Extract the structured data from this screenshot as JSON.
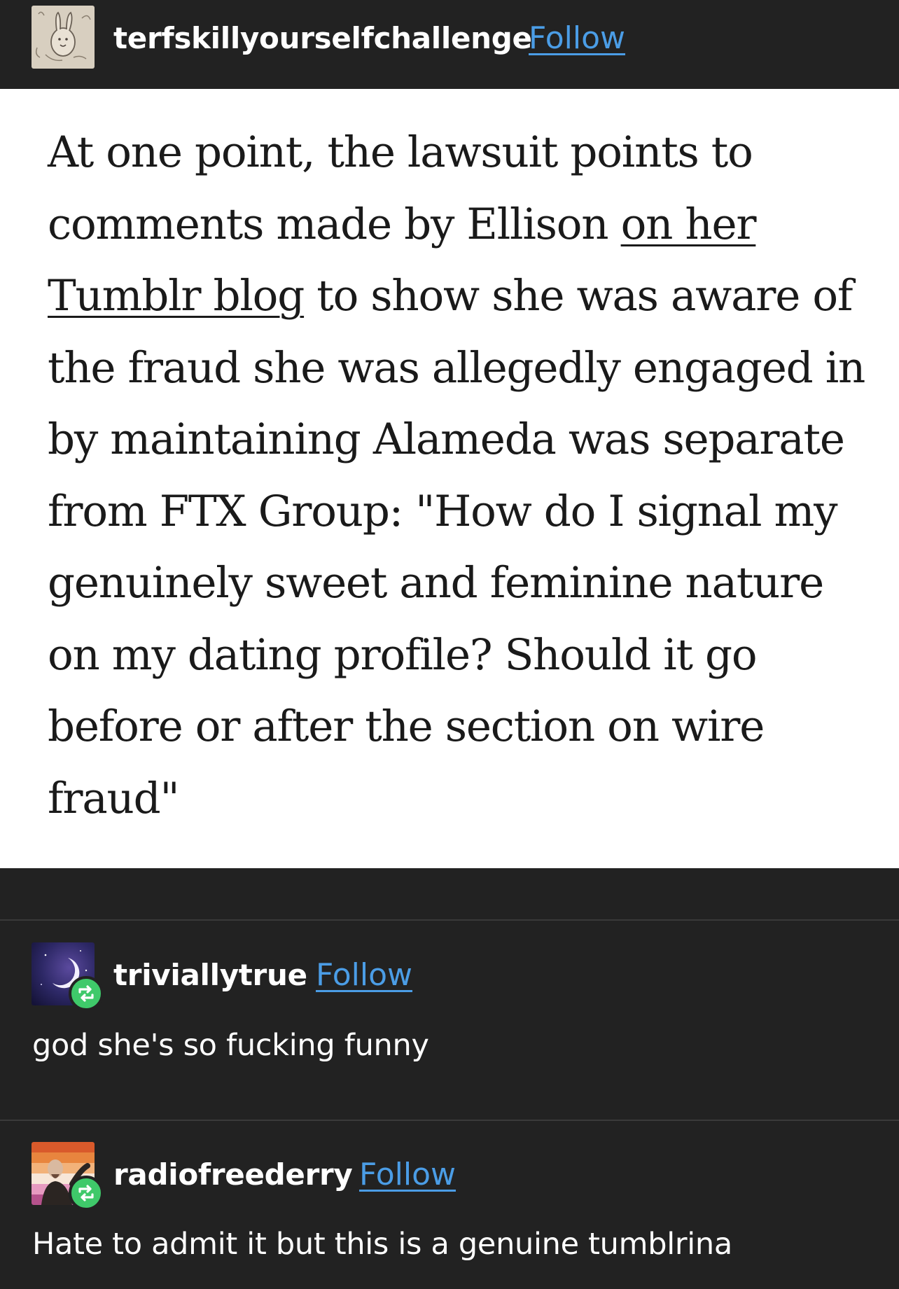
{
  "original_post": {
    "username": "terfskillyourselfchallenge",
    "follow_label": "Follow",
    "quote_lines": [
      {
        "before": "At one point, the lawsuit points to",
        "link": "",
        "after": ""
      },
      {
        "before": "comments made by Ellison ",
        "link": "on her",
        "after": ""
      },
      {
        "before": "",
        "link": "Tumblr blog",
        "after": " to show she was aware of"
      },
      {
        "before": "the fraud she was allegedly engaged in",
        "link": "",
        "after": ""
      },
      {
        "before": "by maintaining Alameda was separate",
        "link": "",
        "after": ""
      },
      {
        "before": "from FTX Group: \"How do I signal my",
        "link": "",
        "after": ""
      },
      {
        "before": "genuinely sweet and feminine nature",
        "link": "",
        "after": ""
      },
      {
        "before": "on my dating profile? Should it go",
        "link": "",
        "after": ""
      },
      {
        "before": "before or after the section on wire",
        "link": "",
        "after": ""
      },
      {
        "before": "fraud\"",
        "link": "",
        "after": ""
      }
    ]
  },
  "reblogs": [
    {
      "username": "triviallytrue",
      "follow_label": "Follow",
      "comment": "god she's so fucking funny"
    },
    {
      "username": "radiofreederry",
      "follow_label": "Follow",
      "comment": "Hate to admit it but this is a genuine tumblrina"
    }
  ],
  "colors": {
    "background": "#222222",
    "quote_background": "#ffffff",
    "follow_link": "#4b9de6",
    "reblog_badge": "#3fc96a"
  },
  "icons": {
    "reblog_badge": "reblog-arrows-icon"
  }
}
